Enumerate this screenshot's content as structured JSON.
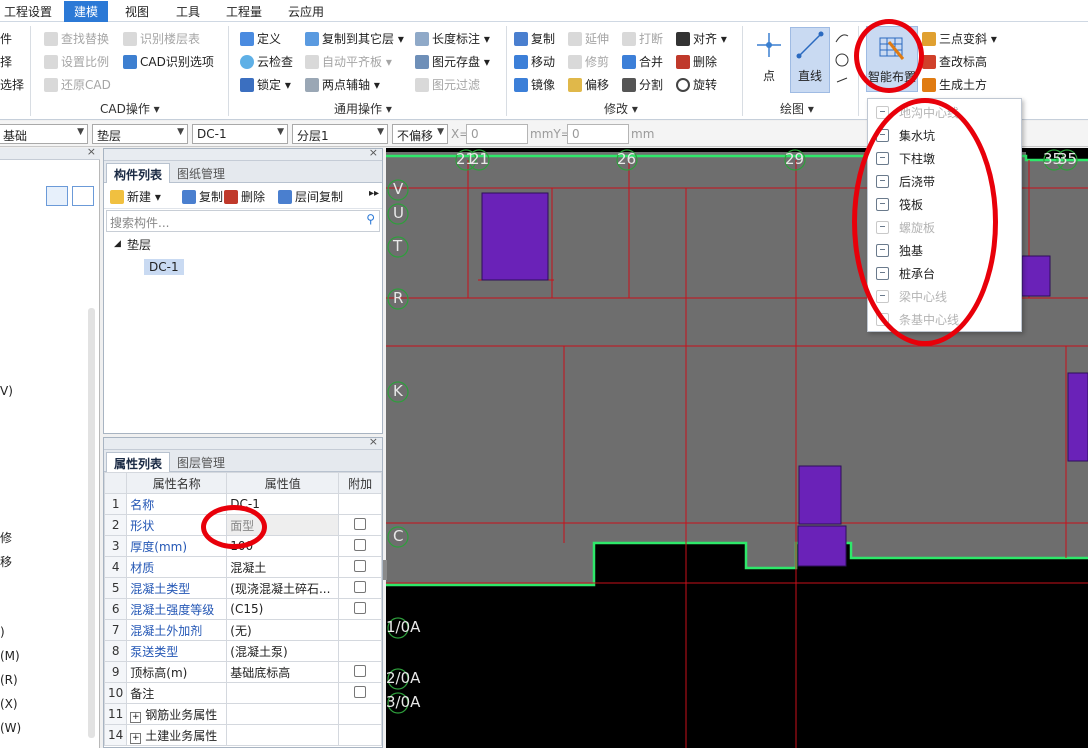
{
  "menu": {
    "items": [
      "工程设置",
      "建模",
      "视图",
      "工具",
      "工程量",
      "云应用"
    ]
  },
  "ribbon": {
    "left_partial": [
      "件",
      "择",
      "选择"
    ],
    "cad": {
      "buttons": [
        "查找替换",
        "识别楼层表",
        "设置比例",
        "CAD识别选项",
        "还原CAD"
      ],
      "group": "CAD操作 ▾"
    },
    "common": {
      "buttons": [
        "定义",
        "复制到其它层 ▾",
        "长度标注 ▾",
        "云检查",
        "自动平齐板 ▾",
        "图元存盘 ▾",
        "锁定 ▾",
        "两点辅轴 ▾",
        "图元过滤"
      ],
      "group": "通用操作 ▾"
    },
    "modify": {
      "buttons": [
        "复制",
        "延伸",
        "打断",
        "对齐 ▾",
        "移动",
        "修剪",
        "合并",
        "删除",
        "镜像",
        "偏移",
        "分割",
        "旋转"
      ],
      "group": "修改 ▾"
    },
    "draw": {
      "buttons": [
        "点",
        "直线"
      ],
      "group": "绘图 ▾"
    },
    "smart": {
      "button": "智能布置",
      "extra": [
        "三点变斜 ▾",
        "查改标高",
        "生成土方"
      ]
    }
  },
  "toolbar": {
    "combo1": "基础",
    "combo2": "垫层",
    "combo3": "DC-1",
    "combo4": "分层1",
    "combo5": "不偏移",
    "x_label": "X=",
    "x_value": "0",
    "y_label": "mmY=",
    "y_value": "0",
    "unit": "mm"
  },
  "leftdock": {
    "fragments": [
      "V)",
      "修",
      "移",
      ")",
      "(M)",
      "(R)",
      "(X)",
      "(W)"
    ]
  },
  "component_panel": {
    "tabs": [
      "构件列表",
      "图纸管理"
    ],
    "actions": [
      "新建 ▾",
      "复制",
      "删除",
      "层间复制"
    ],
    "search_placeholder": "搜索构件...",
    "tree_root": "垫层",
    "tree_item": "DC-1"
  },
  "property_panel": {
    "tabs": [
      "属性列表",
      "图层管理"
    ],
    "headers": [
      "属性名称",
      "属性值",
      "附加"
    ],
    "rows": [
      {
        "n": "1",
        "name": "名称",
        "value": "DC-1",
        "check": false,
        "blue": true
      },
      {
        "n": "2",
        "name": "形状",
        "value": "面型",
        "check": true,
        "blue": true
      },
      {
        "n": "3",
        "name": "厚度(mm)",
        "value": "100",
        "check": true,
        "blue": true
      },
      {
        "n": "4",
        "name": "材质",
        "value": "混凝土",
        "check": true,
        "blue": true
      },
      {
        "n": "5",
        "name": "混凝土类型",
        "value": "(现浇混凝土碎石...",
        "check": true,
        "blue": true
      },
      {
        "n": "6",
        "name": "混凝土强度等级",
        "value": "(C15)",
        "check": true,
        "blue": true
      },
      {
        "n": "7",
        "name": "混凝土外加剂",
        "value": "(无)",
        "check": false,
        "blue": true
      },
      {
        "n": "8",
        "name": "泵送类型",
        "value": "(混凝土泵)",
        "check": false,
        "blue": true
      },
      {
        "n": "9",
        "name": "顶标高(m)",
        "value": "基础底标高",
        "check": true,
        "blue": false
      },
      {
        "n": "10",
        "name": "备注",
        "value": "",
        "check": true,
        "blue": false
      },
      {
        "n": "11",
        "name": "钢筋业务属性",
        "value": "",
        "check": false,
        "blue": false
      },
      {
        "n": "14",
        "name": "土建业务属性",
        "value": "",
        "check": false,
        "blue": false
      }
    ]
  },
  "canvas": {
    "axis_top": [
      "21",
      "21",
      "26",
      "29",
      "35",
      "35"
    ],
    "axis_left": [
      "V",
      "U",
      "T",
      "R",
      "K",
      "C"
    ],
    "axis_bottom": [
      "1/0A",
      "2/0A",
      "3/0A"
    ]
  },
  "dropdown": {
    "items": [
      {
        "label": "地沟中心线",
        "enabled": false
      },
      {
        "label": "集水坑",
        "enabled": true
      },
      {
        "label": "下柱墩",
        "enabled": true
      },
      {
        "label": "后浇带",
        "enabled": true
      },
      {
        "label": "筏板",
        "enabled": true
      },
      {
        "label": "螺旋板",
        "enabled": false
      },
      {
        "label": "独基",
        "enabled": true
      },
      {
        "label": "桩承台",
        "enabled": true
      },
      {
        "label": "梁中心线",
        "enabled": false
      },
      {
        "label": "条基中心线",
        "enabled": false
      }
    ]
  },
  "colors": {
    "accent": "#2b79d6",
    "canvas_bg": "#000000",
    "slab": "#6e6e6e",
    "grid_line": "#c8101a",
    "outline": "#2ee86a",
    "purple_block": "#6a22b8",
    "annotation": "#e8000a"
  }
}
